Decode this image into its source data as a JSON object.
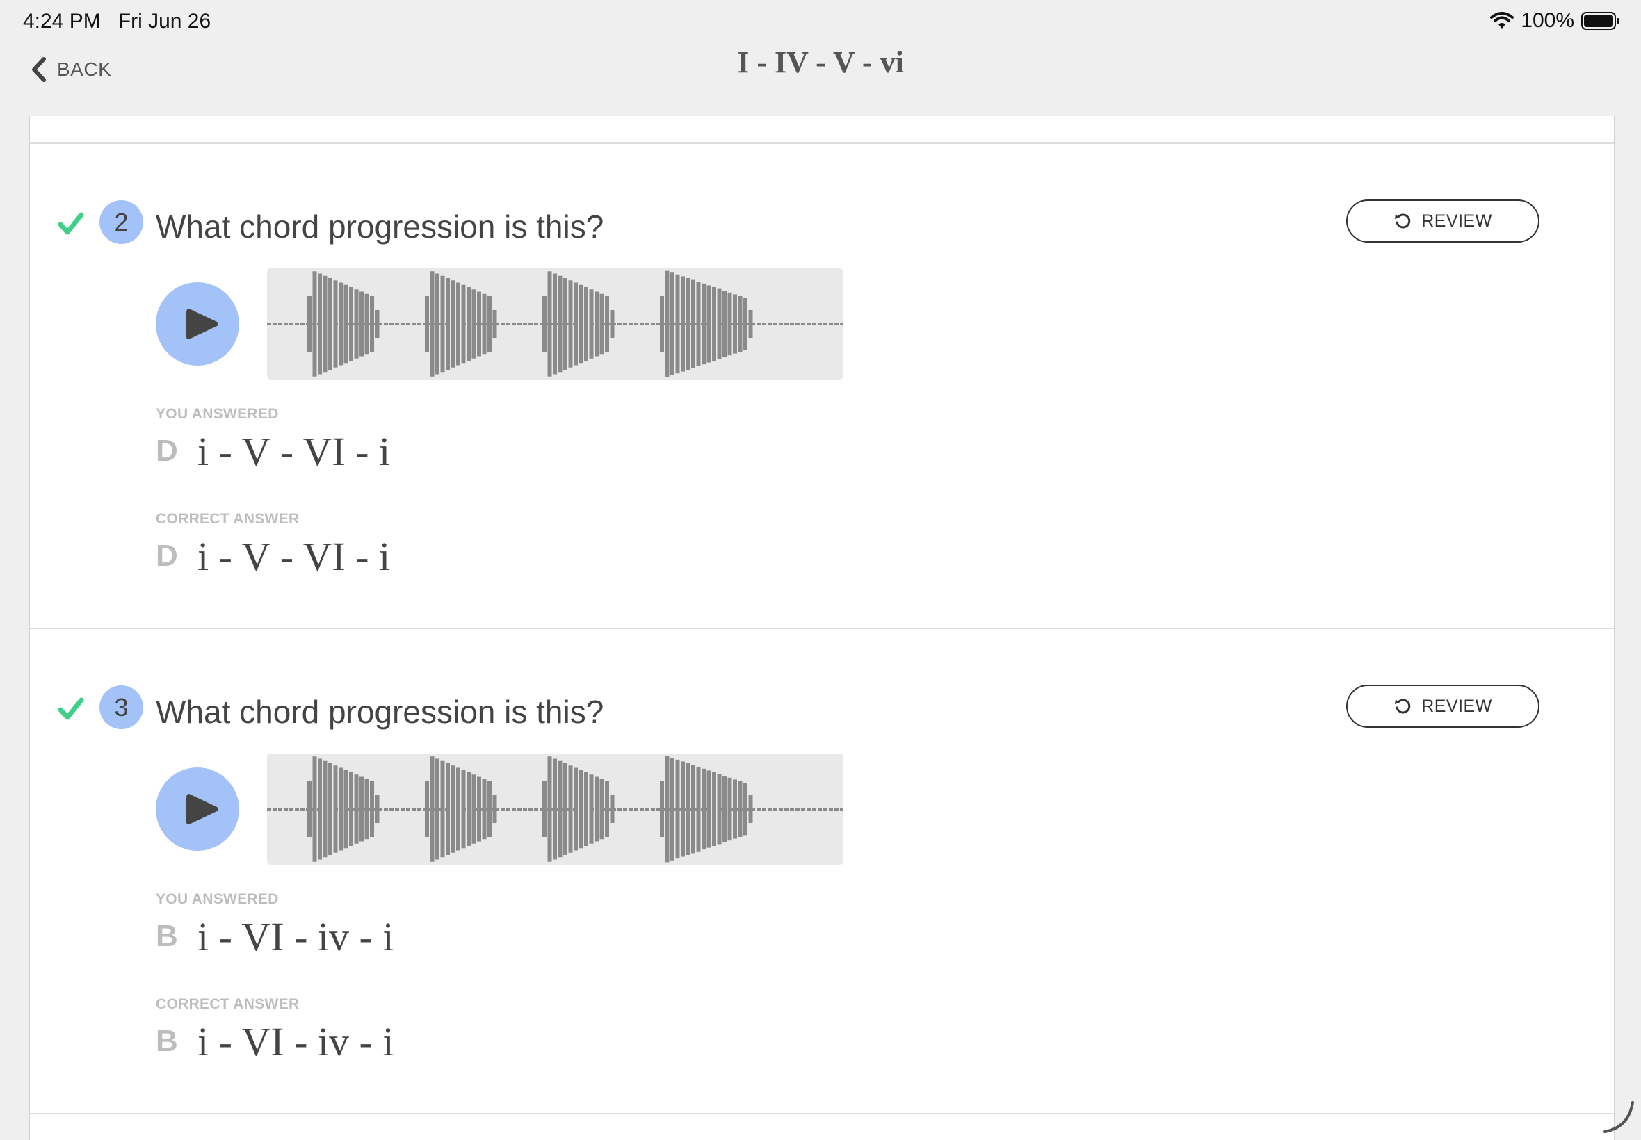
{
  "status": {
    "time": "4:24 PM",
    "date": "Fri Jun 26",
    "battery": "100%"
  },
  "nav": {
    "back_label": "BACK",
    "title": "I - IV - V - vi"
  },
  "colors": {
    "accent_blue": "#a3c2f7",
    "check_green": "#3fcf88",
    "wave_gray": "#8a8a8a"
  },
  "questions": [
    {
      "number": "2",
      "text": "What chord progression is this?",
      "review_label": "REVIEW",
      "you_answered_label": "YOU ANSWERED",
      "you_answered_letter": "D",
      "you_answered_text": "i - V - VI - i",
      "correct_label": "CORRECT ANSWER",
      "correct_letter": "D",
      "correct_text": "i - V - VI - i",
      "is_correct": true
    },
    {
      "number": "3",
      "text": "What chord progression is this?",
      "review_label": "REVIEW",
      "you_answered_label": "YOU ANSWERED",
      "you_answered_letter": "B",
      "you_answered_text": "i - VI - iv - i",
      "correct_label": "CORRECT ANSWER",
      "correct_letter": "B",
      "correct_text": "i - VI - iv - i",
      "is_correct": true
    }
  ],
  "icons": [
    "back-chevron-icon",
    "wifi-icon",
    "battery-icon",
    "check-icon",
    "refresh-icon",
    "play-icon",
    "waveform"
  ]
}
